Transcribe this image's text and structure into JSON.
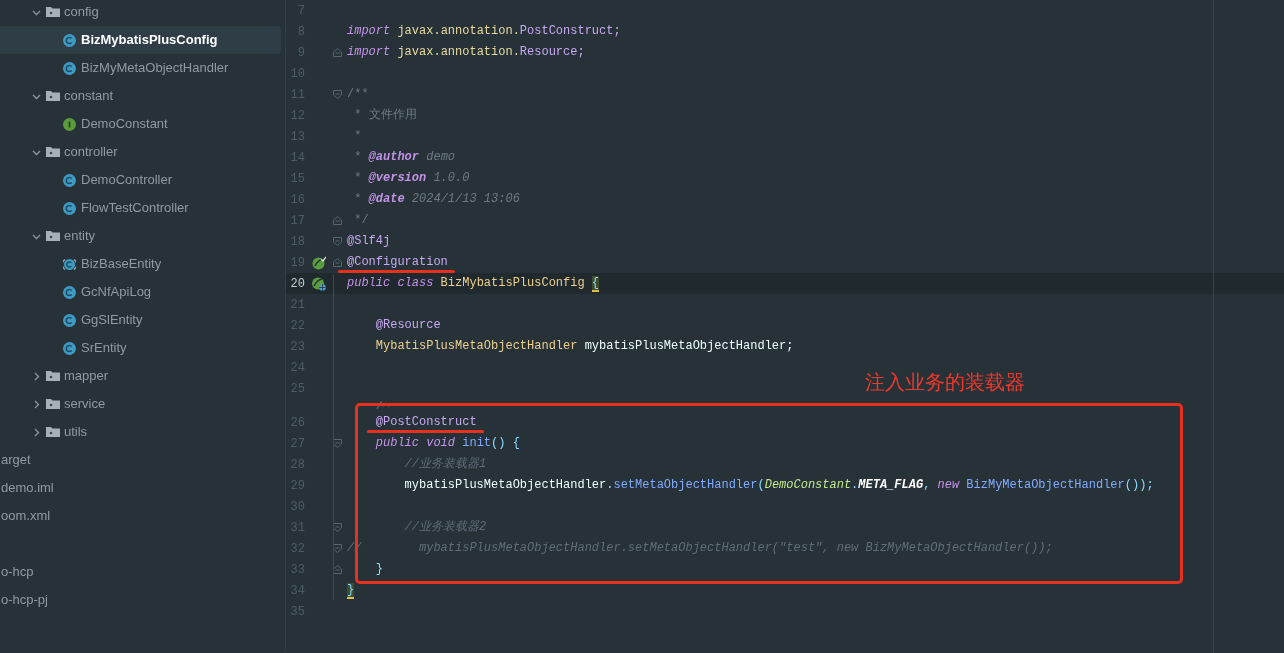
{
  "project_tree": {
    "packages": [
      {
        "label": "config",
        "expanded": true,
        "children": [
          {
            "label": "BizMybatisPlusConfig",
            "kind": "class",
            "selected": true
          },
          {
            "label": "BizMyMetaObjectHandler",
            "kind": "class",
            "selected": false
          }
        ]
      },
      {
        "label": "constant",
        "expanded": true,
        "children": [
          {
            "label": "DemoConstant",
            "kind": "interface",
            "selected": false
          }
        ]
      },
      {
        "label": "controller",
        "expanded": true,
        "children": [
          {
            "label": "DemoController",
            "kind": "class",
            "selected": false
          },
          {
            "label": "FlowTestController",
            "kind": "class",
            "selected": false
          }
        ]
      },
      {
        "label": "entity",
        "expanded": true,
        "children": [
          {
            "label": "BizBaseEntity",
            "kind": "abstract",
            "selected": false
          },
          {
            "label": "GcNfApiLog",
            "kind": "class",
            "selected": false
          },
          {
            "label": "GgSlEntity",
            "kind": "class",
            "selected": false
          },
          {
            "label": "SrEntity",
            "kind": "class",
            "selected": false
          }
        ]
      },
      {
        "label": "mapper",
        "expanded": false
      },
      {
        "label": "service",
        "expanded": false
      },
      {
        "label": "utils",
        "expanded": false
      }
    ],
    "root_items": [
      {
        "label": "arget"
      },
      {
        "label": "demo.iml"
      },
      {
        "label": "oom.xml"
      }
    ],
    "projects": [
      {
        "label": "o-hcp"
      },
      {
        "label": "o-hcp-pj"
      }
    ]
  },
  "editor": {
    "caption": "注入业务的装载器",
    "lines": [
      {
        "kind": "code",
        "number": "7",
        "current": false
      },
      {
        "kind": "code",
        "number": "8",
        "current": false,
        "tokens": [
          {
            "text": "import",
            "kind": "keyword"
          },
          {
            "text": " javax.annotation.",
            "kind": "package"
          },
          {
            "text": "PostConstruct;",
            "kind": "type"
          }
        ]
      },
      {
        "kind": "code",
        "number": "9",
        "current": false,
        "fold": {
          "kind": "end"
        },
        "tokens": [
          {
            "text": "import",
            "kind": "keyword"
          },
          {
            "text": " javax.annotation.",
            "kind": "package"
          },
          {
            "text": "Resource;",
            "kind": "type"
          }
        ]
      },
      {
        "kind": "code",
        "number": "10",
        "current": false
      },
      {
        "kind": "code",
        "number": "11",
        "current": false,
        "fold": {
          "kind": "start"
        },
        "tokens": [
          {
            "text": "/**",
            "kind": "comment"
          }
        ]
      },
      {
        "kind": "code",
        "number": "12",
        "current": false,
        "tokens": [
          {
            "text": " * 文件作用",
            "kind": "comment"
          }
        ]
      },
      {
        "kind": "code",
        "number": "13",
        "current": false,
        "tokens": [
          {
            "text": " *",
            "kind": "comment"
          }
        ]
      },
      {
        "kind": "code",
        "number": "14",
        "current": false,
        "tokens": [
          {
            "text": " * ",
            "kind": "comment"
          },
          {
            "text": "@author",
            "kind": "doctag"
          },
          {
            "text": " demo",
            "kind": "docvalue"
          }
        ]
      },
      {
        "kind": "code",
        "number": "15",
        "current": false,
        "tokens": [
          {
            "text": " * ",
            "kind": "comment"
          },
          {
            "text": "@version",
            "kind": "doctag"
          },
          {
            "text": " 1.0.0",
            "kind": "docvalue"
          }
        ]
      },
      {
        "kind": "code",
        "number": "16",
        "current": false,
        "tokens": [
          {
            "text": " * ",
            "kind": "comment"
          },
          {
            "text": "@date",
            "kind": "doctag"
          },
          {
            "text": " 2024/1/13 13:06",
            "kind": "docvalue"
          }
        ]
      },
      {
        "kind": "code",
        "number": "17",
        "current": false,
        "fold": {
          "kind": "end"
        },
        "tokens": [
          {
            "text": " */",
            "kind": "comment"
          }
        ]
      },
      {
        "kind": "code",
        "number": "18",
        "current": false,
        "fold": {
          "kind": "start"
        },
        "tokens": [
          {
            "text": "@Slf4j",
            "kind": "annotation"
          }
        ]
      },
      {
        "kind": "code",
        "number": "19",
        "current": false,
        "fold": {
          "kind": "end"
        },
        "gutter": {
          "kind": "bean-check"
        },
        "tokens": [
          {
            "text": "@Configuration",
            "kind": "annotation",
            "underlined": true
          }
        ]
      },
      {
        "kind": "code",
        "number": "20",
        "current": true,
        "gutter": {
          "kind": "bean-web"
        },
        "tokens": [
          {
            "text": "public class",
            "kind": "keyword"
          },
          {
            "text": " BizMybatisPlusConfig ",
            "kind": "classname"
          },
          {
            "text": "{",
            "kind": "matched"
          }
        ]
      },
      {
        "kind": "code",
        "number": "21",
        "current": false
      },
      {
        "kind": "code",
        "number": "22",
        "current": false,
        "tokens": [
          {
            "text": "    @Resource",
            "kind": "annotation"
          }
        ]
      },
      {
        "kind": "code",
        "number": "23",
        "current": false,
        "tokens": [
          {
            "text": "    MybatisPlusMetaObjectHandler",
            "kind": "classname"
          },
          {
            "text": " mybatisPlusMetaObjectHandler;",
            "kind": "plain"
          }
        ]
      },
      {
        "kind": "code",
        "number": "24",
        "current": false
      },
      {
        "kind": "code",
        "number": "25",
        "current": false
      },
      {
        "kind": "hint"
      },
      {
        "kind": "code",
        "number": "26",
        "current": false,
        "tokens": [
          {
            "text": "    @PostConstruct",
            "kind": "annotation",
            "underlined": true
          }
        ]
      },
      {
        "kind": "code",
        "number": "27",
        "current": false,
        "fold": {
          "kind": "start"
        },
        "tokens": [
          {
            "text": "    public void",
            "kind": "keyword"
          },
          {
            "text": " init",
            "kind": "method"
          },
          {
            "text": "() {",
            "kind": "punct"
          }
        ]
      },
      {
        "kind": "code",
        "number": "28",
        "current": false,
        "tokens": [
          {
            "text": "        //业务装载器1",
            "kind": "linecomment"
          }
        ]
      },
      {
        "kind": "code",
        "number": "29",
        "current": false,
        "tokens": [
          {
            "text": "        mybatisPlusMetaObjectHandler",
            "kind": "plain"
          },
          {
            "text": ".",
            "kind": "punct"
          },
          {
            "text": "setMetaObjectHandler",
            "kind": "method"
          },
          {
            "text": "(",
            "kind": "punct"
          },
          {
            "text": "DemoConstant",
            "kind": "staticclass"
          },
          {
            "text": ".",
            "kind": "punct"
          },
          {
            "text": "META_FLAG",
            "kind": "constant"
          },
          {
            "text": ", ",
            "kind": "punct"
          },
          {
            "text": "new",
            "kind": "keyword"
          },
          {
            "text": " BizMyMetaObjectHandler",
            "kind": "method"
          },
          {
            "text": "());",
            "kind": "punct"
          }
        ]
      },
      {
        "kind": "code",
        "number": "30",
        "current": false
      },
      {
        "kind": "code",
        "number": "31",
        "current": false,
        "fold": {
          "kind": "start"
        },
        "tokens": [
          {
            "text": "        //业务装载器2",
            "kind": "linecomment"
          }
        ]
      },
      {
        "kind": "code",
        "number": "32",
        "current": false,
        "fold": {
          "kind": "start"
        },
        "tokens": [
          {
            "text": "//        mybatisPlusMetaObjectHandler.setMetaObjectHandler(\"test\", new BizMyMetaObjectHandler());",
            "kind": "linecomment"
          }
        ]
      },
      {
        "kind": "code",
        "number": "33",
        "current": false,
        "fold": {
          "kind": "end"
        },
        "tokens": [
          {
            "text": "    }",
            "kind": "punct"
          }
        ]
      },
      {
        "kind": "code",
        "number": "34",
        "current": false,
        "tokens": [
          {
            "text": "}",
            "kind": "matched"
          }
        ]
      },
      {
        "kind": "code",
        "number": "35",
        "current": false
      }
    ]
  }
}
